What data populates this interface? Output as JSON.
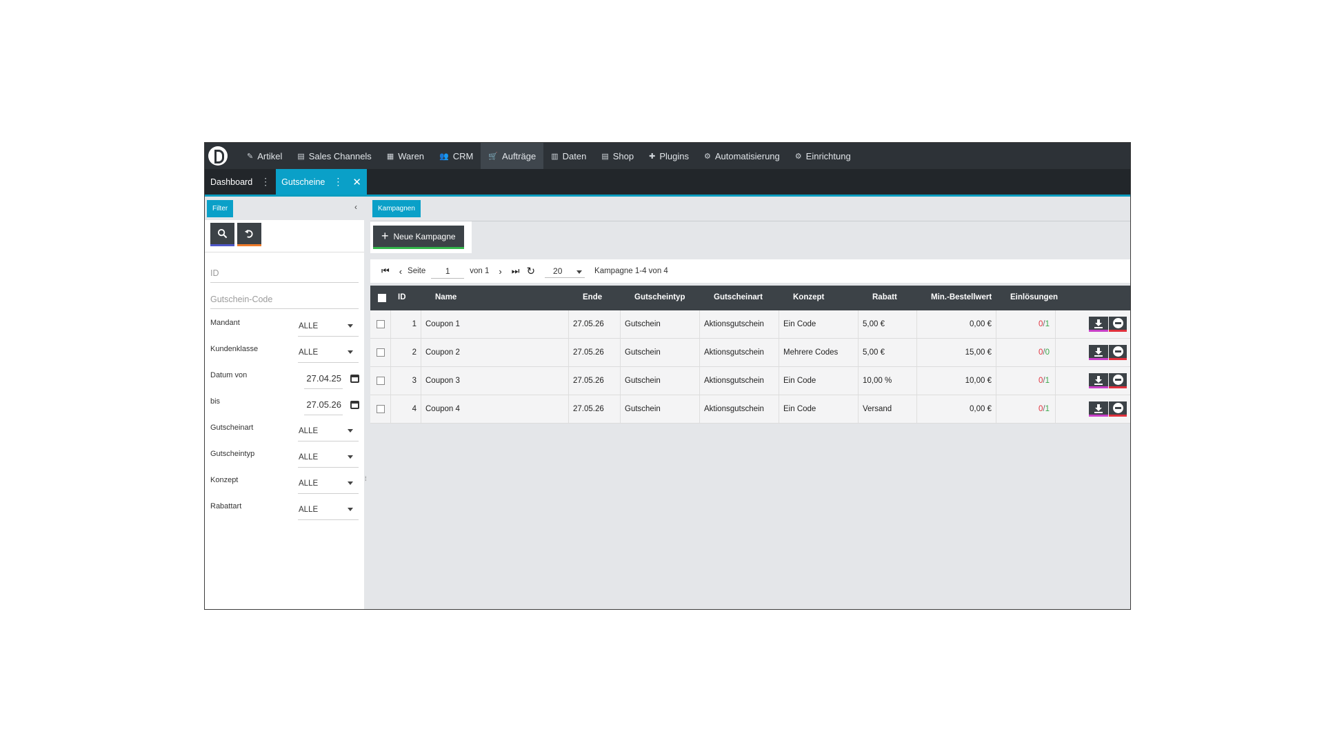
{
  "nav": {
    "items": [
      {
        "label": "Artikel",
        "icon": "tag-icon",
        "glyph": "✎"
      },
      {
        "label": "Sales Channels",
        "icon": "store-icon",
        "glyph": "▤"
      },
      {
        "label": "Waren",
        "icon": "boxes-icon",
        "glyph": "▦"
      },
      {
        "label": "CRM",
        "icon": "users-icon",
        "glyph": "👥"
      },
      {
        "label": "Aufträge",
        "icon": "cart-icon",
        "glyph": "🛒",
        "active": true
      },
      {
        "label": "Daten",
        "icon": "database-icon",
        "glyph": "▥"
      },
      {
        "label": "Shop",
        "icon": "shop-icon",
        "glyph": "▤"
      },
      {
        "label": "Plugins",
        "icon": "puzzle-icon",
        "glyph": "✚"
      },
      {
        "label": "Automatisierung",
        "icon": "flow-icon",
        "glyph": "⚙"
      },
      {
        "label": "Einrichtung",
        "icon": "gear-icon",
        "glyph": "⚙"
      }
    ]
  },
  "tabs": {
    "dashboard": "Dashboard",
    "gutscheine": "Gutscheine",
    "dots": "⋮",
    "close": "✕"
  },
  "filter": {
    "title": "Filter",
    "collapse": "‹",
    "id_placeholder": "ID",
    "code_placeholder": "Gutschein-Code",
    "rows": [
      {
        "label": "Mandant",
        "value": "ALLE"
      },
      {
        "label": "Kundenklasse",
        "value": "ALLE"
      }
    ],
    "date_from_label": "Datum von",
    "date_from": "27.04.25",
    "date_to_label": "bis",
    "date_to": "27.05.26",
    "rows2": [
      {
        "label": "Gutscheinart",
        "value": "ALLE"
      },
      {
        "label": "Gutscheintyp",
        "value": "ALLE"
      },
      {
        "label": "Konzept",
        "value": "ALLE"
      },
      {
        "label": "Rabattart",
        "value": "ALLE"
      }
    ]
  },
  "main": {
    "tab_label": "Kampagnen",
    "new_button": "Neue Kampagne",
    "pager": {
      "page_label": "Seite",
      "page": "1",
      "of": "von 1",
      "per_page": "20",
      "range": "Kampagne  1-4 von 4"
    },
    "columns": [
      "ID",
      "Name",
      "Ende",
      "Gutscheintyp",
      "Gutscheinart",
      "Konzept",
      "Rabatt",
      "Min.-Bestellwert",
      "Einlösungen"
    ],
    "rows": [
      {
        "id": "1",
        "name": "Coupon 1",
        "ende": "27.05.26",
        "typ": "Gutschein",
        "art": "Aktionsgutschein",
        "konzept": "Ein Code",
        "rabatt": "5,00 €",
        "min": "0,00 €",
        "used": "0",
        "total": "1"
      },
      {
        "id": "2",
        "name": "Coupon 2",
        "ende": "27.05.26",
        "typ": "Gutschein",
        "art": "Aktionsgutschein",
        "konzept": "Mehrere Codes",
        "rabatt": "5,00 €",
        "min": "15,00 €",
        "used": "0",
        "total": "0"
      },
      {
        "id": "3",
        "name": "Coupon 3",
        "ende": "27.05.26",
        "typ": "Gutschein",
        "art": "Aktionsgutschein",
        "konzept": "Ein Code",
        "rabatt": "10,00 %",
        "min": "10,00 €",
        "used": "0",
        "total": "1"
      },
      {
        "id": "4",
        "name": "Coupon 4",
        "ende": "27.05.26",
        "typ": "Gutschein",
        "art": "Aktionsgutschein",
        "konzept": "Ein Code",
        "rabatt": "Versand",
        "min": "0,00 €",
        "used": "0",
        "total": "1"
      }
    ]
  },
  "colors": {
    "accent": "#0aa0c8",
    "dark": "#3c4247",
    "nav": "#2d3237",
    "red": "#e0313d",
    "green": "#33b54a"
  }
}
